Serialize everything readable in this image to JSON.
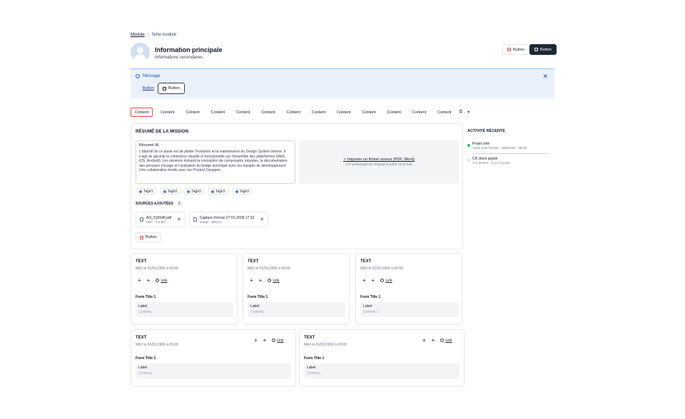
{
  "breadcrumb": {
    "parent": "Module",
    "current": "fiche module"
  },
  "header": {
    "title": "Information principale",
    "subtitle": "Informations secondaires",
    "button_outline": "Button",
    "button_primary": "Button"
  },
  "banner": {
    "message": "Message",
    "link_button": "Button",
    "outline_button": "Button"
  },
  "tabs": [
    "Content",
    "Content",
    "Content",
    "Content",
    "Content",
    "Content",
    "Content",
    "Content",
    "Content",
    "Content",
    "Content",
    "Content",
    "Content"
  ],
  "tabs_more": "..",
  "mission": {
    "title": "RÉSUMÉ DE LA MISSION",
    "resume_title": "Résumé IA",
    "resume_body": "L'objectif de ce poste est de piloter l'évolution et la maintenance du Design System interne. Il s'agit de garantir la cohérence visuelle et fonctionnelle sur l'ensemble des plateformes (Web, iOS, Android). Les missions incluent la conception de composants robustes, la documentation des principes d'usage et l'animation du bridge technique avec les équipes de développement. Une collaboration étroite avec les Product Designer...",
    "upload_label": "Importer un fichier source (PDF, Word)",
    "upload_hint": "L'IA préremplit les champs à partir du fichier",
    "tags": [
      "Tag#1",
      "Tag#2",
      "Tag#2",
      "Tag#2",
      "Tag#2"
    ],
    "sources_title": "SOURCES AJOUTÉES",
    "sources_count": "2",
    "files": [
      {
        "name": "AO_516548.pdf",
        "meta": "PDF - 3,2 Mo"
      },
      {
        "name": "Capture d'écran 27-01-2026 17:23",
        "meta": "Image - 550 Ko"
      }
    ],
    "button": "Button"
  },
  "activity": {
    "title": "ACTIVITÉ RÉCENTE",
    "items": [
      {
        "title": "Projet créé",
        "sub": "Anne-Lise Dunne - 03/01/25 - 09:45",
        "color": "#22c55e"
      },
      {
        "title": "CR client ajouté",
        "sub": "A-L Dunne - il y a 3 jours",
        "color": "#d1d5db"
      }
    ]
  },
  "text_cards": [
    {
      "title": "TEXT",
      "sub": "MAJ le 01/01/1900 à 00:00",
      "link": "Link",
      "form_title": "Form Title 1",
      "label": "Label",
      "placeholder": "Contenu"
    },
    {
      "title": "TEXT",
      "sub": "MAJ le 01/01/1900 à 00:00",
      "link": "Link",
      "form_title": "Form Title 1",
      "label": "Label",
      "placeholder": "Contenu"
    },
    {
      "title": "TEXT",
      "sub": "MAJ le 01/01/1900 à 00:00",
      "link": "Link",
      "form_title": "Form Title 1",
      "label": "Label",
      "placeholder": "Contenu"
    },
    {
      "title": "TEXT",
      "sub": "MAJ le 01/01/1900 à 00:00",
      "link": "Link",
      "form_title": "Form Title 1",
      "label": "Label",
      "placeholder": "Contenu"
    },
    {
      "title": "TEXT",
      "sub": "MAJ le 01/01/1900 à 00:00",
      "link": "Link",
      "form_title": "Form Title 1",
      "label": "Label",
      "placeholder": "Contenu"
    }
  ],
  "icons": {
    "plus": "+",
    "close": "✕",
    "sparkle": "✧"
  },
  "colors": {
    "accent": "#ef4444",
    "banner": "#eaf1fb",
    "tag_dot": "#3b82f6",
    "primary": "#1f2937"
  }
}
